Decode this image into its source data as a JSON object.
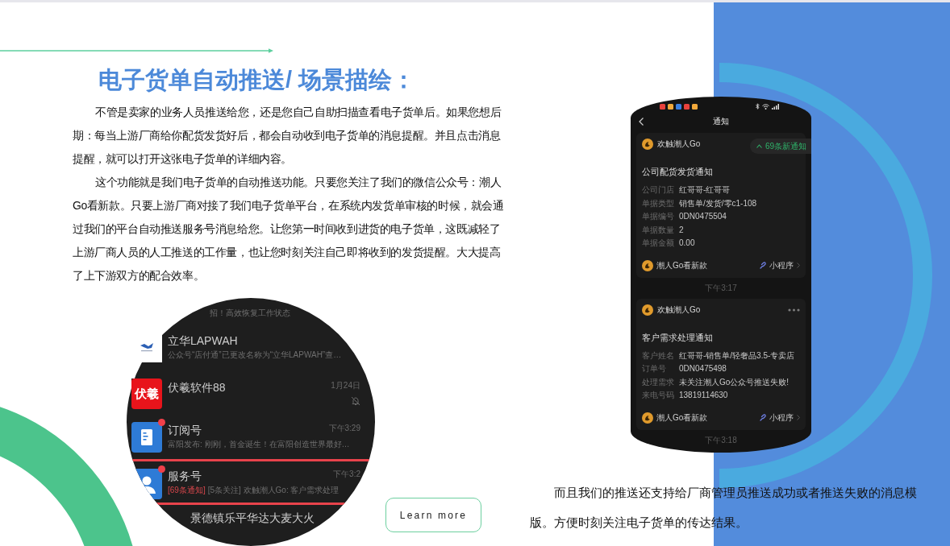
{
  "heading": {
    "title": "电子货单自动推送/ 场景描绘："
  },
  "paragraphs": [
    "不管是卖家的业务人员推送给您，还是您自己自助扫描查看电子货单后。如果您想后期：每当上游厂商给你配货发货好后，都会自动收到电子货单的消息提醒。并且点击消息提醒，就可以打开这张电子货单的详细内容。",
    "这个功能就是我们电子货单的自动推送功能。只要您关注了我们的微信公众号：潮人Go看新款。只要上游厂商对接了我们电子货单平台，在系统内发货单审核的时候，就会通过我们的平台自动推送服务号消息给您。让您第一时间收到进货的电子货单，这既减轻了上游厂商人员的人工推送的工作量，也让您时刻关注自己即将收到的发货提醒。大大提高了上下游双方的配合效率。"
  ],
  "chat_screenshot": {
    "cut_preview": "招！高效恢复工作状态",
    "chats": [
      {
        "kind": "logo",
        "name": "立华LAPWAH",
        "preview": "公众号“店付通”已更改名称为“立华LAPWAH”查…",
        "unread": false,
        "muted": false,
        "highlighted": false
      },
      {
        "kind": "text_logo",
        "logo_text": "伏羲",
        "name": "伏羲软件88",
        "time": "1月24日",
        "unread": false,
        "muted": true,
        "highlighted": false
      },
      {
        "kind": "document",
        "name": "订阅号",
        "time": "下午3:29",
        "preview": "富阳发布: 刚刚，首金诞生！在富阳创造世界最好…",
        "unread": true,
        "muted": false,
        "highlighted": false
      },
      {
        "kind": "person",
        "name": "服务号",
        "time": "下午3:2",
        "badge": "[69条通知]",
        "preview": "[5条关注] 欢触潮人Go: 客户需求处理",
        "unread": true,
        "muted": false,
        "highlighted": true
      },
      {
        "kind": "plain",
        "name": "景德镇乐平华达大麦大火",
        "unread": false,
        "muted": false,
        "highlighted": false
      }
    ]
  },
  "notice_screenshot": {
    "title": "通知",
    "new_notice": "69条新通知",
    "feed": [
      {
        "kind": "card",
        "sender": "欢触潮人Go",
        "menu": false,
        "heading": "公司配货发货通知",
        "fields": [
          {
            "label": "公司门店",
            "value": "红哥哥-红哥哥"
          },
          {
            "label": "单据类型",
            "value": "销售单/发货/零c1-108"
          },
          {
            "label": "单据编号",
            "value": "0DN0475504"
          },
          {
            "label": "单据数量",
            "value": "2"
          },
          {
            "label": "单据金额",
            "value": "0.00"
          }
        ],
        "account": "潮人Go看新款",
        "link": "小程序"
      },
      {
        "kind": "time",
        "text": "下午3:17"
      },
      {
        "kind": "card",
        "sender": "欢触潮人Go",
        "menu": true,
        "heading": "客户需求处理通知",
        "fields": [
          {
            "label": "客户姓名",
            "value": "红哥哥-销售单/轻奢品3.5-专卖店"
          },
          {
            "label": "订单号",
            "value": "0DN0475498"
          },
          {
            "label": "处理需求",
            "value": "未关注潮人Go公众号推送失败!"
          },
          {
            "label": "来电号码",
            "value": "13819114630"
          }
        ],
        "account": "潮人Go看新款",
        "link": "小程序"
      },
      {
        "kind": "time",
        "text": "下午3:18"
      }
    ]
  },
  "learn_more": {
    "label": "Learn more"
  },
  "closing_paragraph": "而且我们的推送还支持给厂商管理员推送成功或者推送失败的消息模版。方便时刻关注电子货单的传达结果。"
}
